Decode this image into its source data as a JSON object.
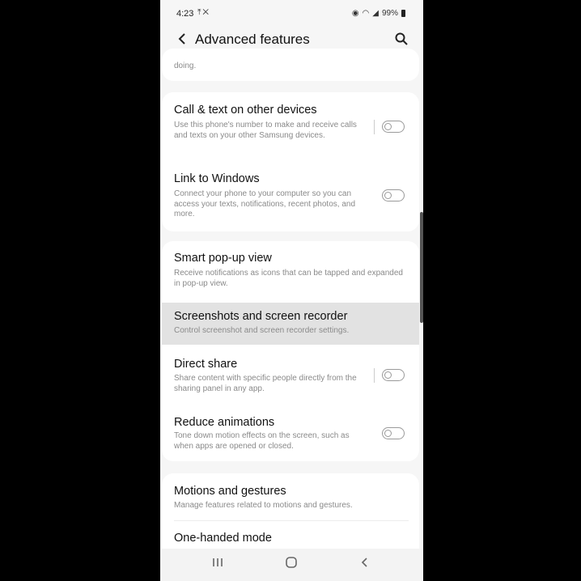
{
  "status_bar": {
    "time": "4:23",
    "left_icons": [
      "upload-icon",
      "missed-call-icon"
    ],
    "right_icons": [
      "alarm-icon",
      "wifi-icon",
      "signal-icon",
      "signal-icon"
    ],
    "battery": "99%"
  },
  "app_bar": {
    "title": "Advanced features"
  },
  "top_fragment": {
    "text": "doing."
  },
  "card1": {
    "items": [
      {
        "title": "Call & text on other devices",
        "desc": "Use this phone's number to make and receive calls and texts on your other Samsung devices.",
        "toggle_on": false
      },
      {
        "title": "Link to Windows",
        "desc": "Connect your phone to your computer so you can access your texts, notifications, recent photos, and more.",
        "toggle_on": false
      }
    ]
  },
  "card2": {
    "items": [
      {
        "title": "Smart pop-up view",
        "desc": "Receive notifications as icons that can be tapped and expanded in pop-up view."
      },
      {
        "title": "Screenshots and screen recorder",
        "desc": "Control screenshot and screen recorder settings."
      },
      {
        "title": "Direct share",
        "desc": "Share content with specific people directly from the sharing panel in any app.",
        "toggle_on": false
      },
      {
        "title": "Reduce animations",
        "desc": "Tone down motion effects on the screen, such as when apps are opened or closed.",
        "toggle_on": false
      }
    ]
  },
  "card3": {
    "items": [
      {
        "title": "Motions and gestures",
        "desc": "Manage features related to motions and gestures."
      },
      {
        "title": "One-handed mode",
        "desc": ""
      }
    ]
  },
  "nav_bar": {
    "recents_icon": "recents-icon",
    "home_icon": "home-icon",
    "back_icon": "back-icon"
  },
  "colors": {
    "background": "#f6f6f6",
    "card": "#ffffff",
    "highlight": "#e2e2e2",
    "text": "#111111",
    "subtext": "#8a8a8a"
  }
}
